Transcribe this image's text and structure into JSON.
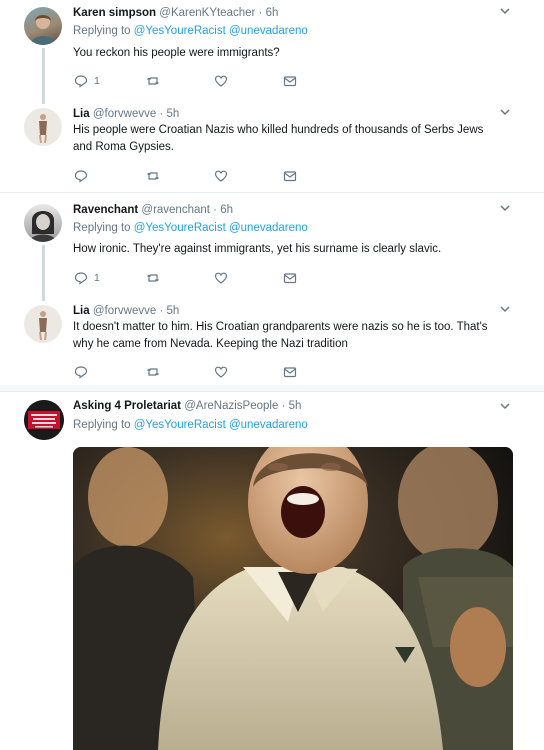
{
  "tweets": [
    {
      "name": "Karen simpson",
      "handle": "@KarenKYteacher",
      "time": "6h",
      "replying_prefix": "Replying to",
      "reply_handles": [
        "@YesYoureRacist",
        "@unevadareno"
      ],
      "text": "You reckon his people were immigrants?",
      "reply_count": "1"
    },
    {
      "name": "Lia",
      "handle": "@forvwevve",
      "time": "5h",
      "text_lines": [
        "His people were Croatian Nazis who killed hundreds of thousands of Serbs Jews",
        "and Roma Gypsies."
      ]
    },
    {
      "name": "Ravenchant",
      "handle": "@ravenchant",
      "time": "6h",
      "replying_prefix": "Replying to",
      "reply_handles": [
        "@YesYoureRacist",
        "@unevadareno"
      ],
      "text": "How ironic. They're against immigrants, yet his surname is clearly slavic.",
      "reply_count": "1"
    },
    {
      "name": "Lia",
      "handle": "@forvwevve",
      "time": "5h",
      "text_lines": [
        "It doesn't matter to him. His Croatian grandparents were nazis so he is too. That's",
        "why he came from Nevada. Keeping the Nazi tradition"
      ]
    },
    {
      "name": "Asking 4 Proletariat",
      "handle": "@AreNazisPeople",
      "time": "5h",
      "replying_prefix": "Replying to",
      "reply_handles": [
        "@YesYoureRacist",
        "@unevadareno"
      ],
      "avatar_text": "NO NAZIS DESERVE THE SAME RIGHTS AS PEOPLE"
    }
  ],
  "dot": "·",
  "icons": {
    "reply": "reply-icon",
    "retweet": "retweet-icon",
    "like": "heart-icon",
    "dm": "envelope-icon",
    "more": "chevron-down-icon"
  },
  "colors": {
    "link": "#1da1f2",
    "secondary": "#657786",
    "thread": "#cfd9de",
    "avatar_red": "#c8102e"
  }
}
